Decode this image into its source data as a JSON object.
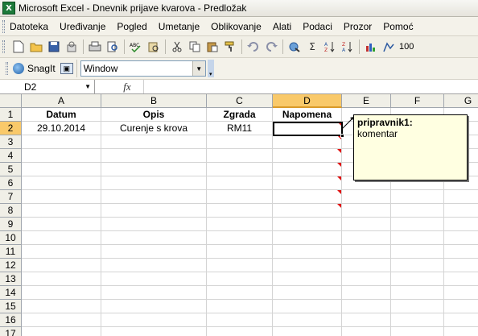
{
  "window": {
    "title": "Microsoft Excel - Dnevnik prijave kvarova - Predložak",
    "app_icon_letter": "X"
  },
  "menu": [
    {
      "label": "Datoteka"
    },
    {
      "label": "Uređivanje"
    },
    {
      "label": "Pogled"
    },
    {
      "label": "Umetanje"
    },
    {
      "label": "Oblikovanje"
    },
    {
      "label": "Alati"
    },
    {
      "label": "Podaci"
    },
    {
      "label": "Prozor"
    },
    {
      "label": "Pomoć"
    }
  ],
  "toolbar": {
    "icons": [
      "new-icon",
      "open-icon",
      "save-icon",
      "permission-icon",
      "print-icon",
      "print-preview-icon",
      "spelling-icon",
      "research-icon",
      "cut-icon",
      "copy-icon",
      "paste-icon",
      "format-painter-icon",
      "undo-icon",
      "redo-icon",
      "hyperlink-icon",
      "autosum-icon",
      "sort-ascending-icon",
      "sort-descending-icon",
      "chart-wizard-icon",
      "drawing-icon"
    ],
    "autosum_glyph": "Σ",
    "zoom": "100"
  },
  "snagit": {
    "label": "SnagIt",
    "combo_value": "Window"
  },
  "formula_bar": {
    "name_box": "D2",
    "fx": "fx",
    "value": ""
  },
  "sheet": {
    "columns": [
      "A",
      "B",
      "C",
      "D",
      "E",
      "F",
      "G"
    ],
    "active_column": "D",
    "active_row": "2",
    "rows": [
      {
        "n": "1",
        "cells": [
          "Datum",
          "Opis",
          "Zgrada",
          "Napomena",
          "",
          "",
          ""
        ]
      },
      {
        "n": "2",
        "cells": [
          "29.10.2014",
          "Curenje s krova",
          "RM11",
          "",
          "",
          "",
          ""
        ]
      },
      {
        "n": "3",
        "cells": [
          "",
          "",
          "",
          "",
          "",
          "",
          ""
        ]
      },
      {
        "n": "4",
        "cells": [
          "",
          "",
          "",
          "",
          "",
          "",
          ""
        ]
      },
      {
        "n": "5",
        "cells": [
          "",
          "",
          "",
          "",
          "",
          "",
          ""
        ]
      },
      {
        "n": "6",
        "cells": [
          "",
          "",
          "",
          "",
          "",
          "",
          ""
        ]
      },
      {
        "n": "7",
        "cells": [
          "",
          "",
          "",
          "",
          "",
          "",
          ""
        ]
      },
      {
        "n": "8",
        "cells": [
          "",
          "",
          "",
          "",
          "",
          "",
          ""
        ]
      },
      {
        "n": "9",
        "cells": [
          "",
          "",
          "",
          "",
          "",
          "",
          ""
        ]
      },
      {
        "n": "10",
        "cells": [
          "",
          "",
          "",
          "",
          "",
          "",
          ""
        ]
      },
      {
        "n": "11",
        "cells": [
          "",
          "",
          "",
          "",
          "",
          "",
          ""
        ]
      },
      {
        "n": "12",
        "cells": [
          "",
          "",
          "",
          "",
          "",
          "",
          ""
        ]
      },
      {
        "n": "13",
        "cells": [
          "",
          "",
          "",
          "",
          "",
          "",
          ""
        ]
      },
      {
        "n": "14",
        "cells": [
          "",
          "",
          "",
          "",
          "",
          "",
          ""
        ]
      },
      {
        "n": "15",
        "cells": [
          "",
          "",
          "",
          "",
          "",
          "",
          ""
        ]
      },
      {
        "n": "16",
        "cells": [
          "",
          "",
          "",
          "",
          "",
          "",
          ""
        ]
      },
      {
        "n": "17",
        "cells": [
          "",
          "",
          "",
          "",
          "",
          "",
          ""
        ]
      }
    ]
  },
  "comment": {
    "author": "pripravnik1:",
    "text": "komentar"
  },
  "colors": {
    "active_header": "#f9c96a",
    "comment_bg": "#ffffe1",
    "comment_indicator": "#e01010"
  }
}
